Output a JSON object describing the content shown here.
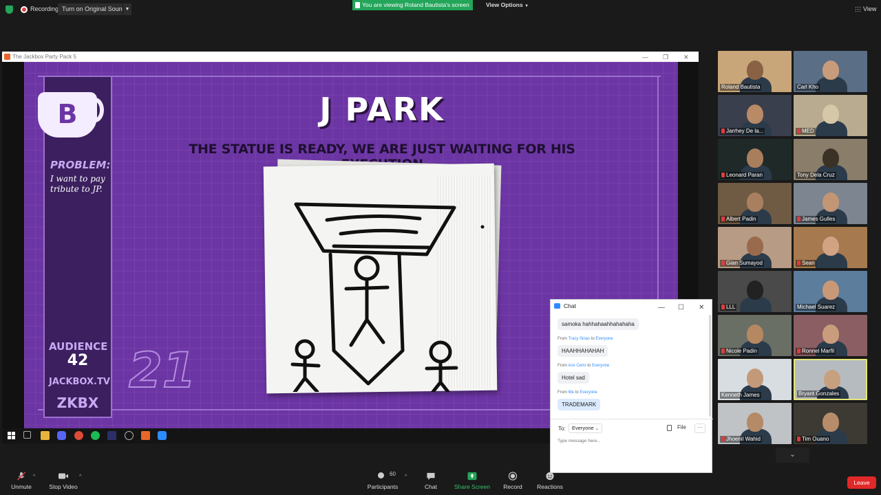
{
  "top_bar": {
    "recording_label": "Recording",
    "sound_button": "Turn on Original Sound",
    "viewing_banner": "You are viewing Roland Bautista's screen",
    "view_options": "View Options",
    "view_label": "View"
  },
  "shared_window": {
    "title": "The Jackbox Party Pack 5"
  },
  "game": {
    "badge_letter": "B",
    "player": "J PARK",
    "prompt": "THE STATUE IS READY, WE ARE JUST WAITING FOR HIS EXECUTION",
    "problem_label": "PROBLEM:",
    "problem_text": "I want to pay tribute to JP.",
    "audience_label": "AUDIENCE",
    "audience_count": "42",
    "site": "JACKBOX.TV",
    "room_code": "ZKBX",
    "timer": "21"
  },
  "participants": [
    {
      "name": "Roland Bautista",
      "muted": false,
      "bg": "#c9a679",
      "face": "#8a6145"
    },
    {
      "name": "Carl Kho",
      "muted": false,
      "bg": "#5a6e85",
      "face": "#c89c7a"
    },
    {
      "name": "Jarrhey De la...",
      "muted": true,
      "bg": "#3a3f4d",
      "face": "#b88a66"
    },
    {
      "name": "MED",
      "muted": true,
      "bg": "#b8ab8f",
      "face": "#d6c7a8"
    },
    {
      "name": "Leonard Paran",
      "muted": true,
      "bg": "#1f2a28",
      "face": "#a87e5d"
    },
    {
      "name": "Tony Dela Cruz",
      "muted": false,
      "bg": "#8a7e6a",
      "face": "#3b3226"
    },
    {
      "name": "Albert Padin",
      "muted": true,
      "bg": "#6f5a43",
      "face": "#a8805f"
    },
    {
      "name": "James Gulles",
      "muted": true,
      "bg": "#7d8590",
      "face": "#c29674"
    },
    {
      "name": "Gian Sumayod",
      "muted": true,
      "bg": "#b89b84",
      "face": "#9a6a4c"
    },
    {
      "name": "Sean",
      "muted": true,
      "bg": "#a67a4e",
      "face": "#d1a383"
    },
    {
      "name": "LLL",
      "muted": true,
      "bg": "#4a4a4a",
      "face": "#222222"
    },
    {
      "name": "Michael Suarez",
      "muted": false,
      "bg": "#5c7d9c",
      "face": "#c99877"
    },
    {
      "name": "Nicole Padin",
      "muted": true,
      "bg": "#6a6f66",
      "face": "#b58862"
    },
    {
      "name": "Ronnel Marfil",
      "muted": true,
      "bg": "#8a5e62",
      "face": "#c99c7c"
    },
    {
      "name": "Kenneth James",
      "muted": false,
      "bg": "#d8dde1",
      "face": "#c39a79"
    },
    {
      "name": "Bryant Gonzales",
      "muted": false,
      "bg": "#b6bbbf",
      "face": "#c7a07f"
    },
    {
      "name": "Jhoenil Wahid",
      "muted": true,
      "bg": "#bfc3c6",
      "face": "#b58a66"
    },
    {
      "name": "Tim Ouano",
      "muted": true,
      "bg": "#3d3a34",
      "face": "#b68c6a"
    }
  ],
  "chat": {
    "title": "Chat",
    "messages": [
      {
        "from": "",
        "to": "",
        "text": "samoka hahhahaahhahahaha"
      },
      {
        "from": "Tracy Sinas",
        "to": "Everyone",
        "text": "HAAHHAHAHAH"
      },
      {
        "from": "Ace Cerio",
        "to": "Everyone",
        "text": "Hotel sad"
      },
      {
        "from": "Me",
        "to": "Everyone",
        "text": "TRADEMARK"
      }
    ],
    "from_prefix": "From",
    "to_word": "to",
    "to_label": "To:",
    "recipient": "Everyone",
    "file_label": "File",
    "more_label": "···",
    "placeholder": "Type message here..."
  },
  "toolbar": {
    "unmute": "Unmute",
    "stop_video": "Stop Video",
    "participants": "Participants",
    "participants_count": "60",
    "chat": "Chat",
    "share_screen": "Share Screen",
    "record": "Record",
    "reactions": "Reactions",
    "leave": "Leave"
  },
  "colors": {
    "accent_green": "#23a55a",
    "leave_red": "#e02828",
    "game_purple": "#6c35a4",
    "active_speaker": "#e6e67a"
  }
}
